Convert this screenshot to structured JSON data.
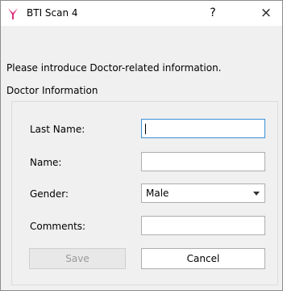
{
  "window": {
    "title": "BTI Scan 4",
    "help_label": "?",
    "close_label": "×"
  },
  "dialog": {
    "instruction": "Please introduce Doctor-related information.",
    "group_title": "Doctor Information"
  },
  "form": {
    "last_name_label": "Last Name:",
    "last_name_value": "",
    "name_label": "Name:",
    "name_value": "",
    "gender_label": "Gender:",
    "gender_value": "Male",
    "comments_label": "Comments:",
    "comments_value": ""
  },
  "buttons": {
    "save_label": "Save",
    "cancel_label": "Cancel"
  },
  "colors": {
    "app_logo": "#e0307a",
    "focus_border": "#3c8fd9"
  },
  "icons": {
    "logo": "app-logo-icon",
    "help": "help-icon",
    "close": "close-icon",
    "dropdown": "chevron-down-icon"
  }
}
